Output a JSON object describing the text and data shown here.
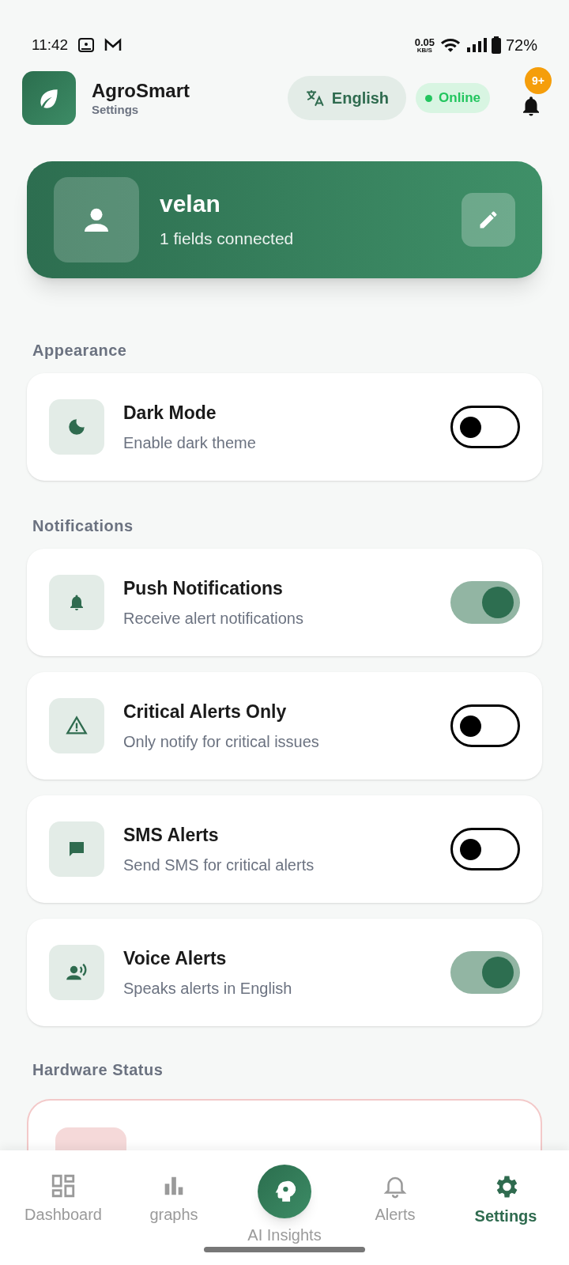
{
  "status_bar": {
    "time": "11:42",
    "net_speed": "0.05",
    "net_unit": "KB/S",
    "battery": "72%"
  },
  "header": {
    "app_name": "AgroSmart",
    "subtitle": "Settings",
    "language": "English",
    "connection": "Online",
    "notification_badge": "9+"
  },
  "profile": {
    "name": "velan",
    "detail": "1 fields connected"
  },
  "sections": [
    {
      "title": "Appearance",
      "items": [
        {
          "title": "Dark Mode",
          "subtitle": "Enable dark theme",
          "on": false
        }
      ]
    },
    {
      "title": "Notifications",
      "items": [
        {
          "title": "Push Notifications",
          "subtitle": "Receive alert notifications",
          "on": true
        },
        {
          "title": "Critical Alerts Only",
          "subtitle": "Only notify for critical issues",
          "on": false
        },
        {
          "title": "SMS Alerts",
          "subtitle": "Send SMS for critical alerts",
          "on": false
        },
        {
          "title": "Voice Alerts",
          "subtitle": "Speaks alerts in English",
          "on": true
        }
      ]
    }
  ],
  "hardware": {
    "title": "Hardware Status"
  },
  "bottom_nav": [
    {
      "label": "Dashboard",
      "selected": false
    },
    {
      "label": "graphs",
      "selected": false
    },
    {
      "label": "AI Insights",
      "selected": false
    },
    {
      "label": "Alerts",
      "selected": false
    },
    {
      "label": "Settings",
      "selected": true
    }
  ]
}
